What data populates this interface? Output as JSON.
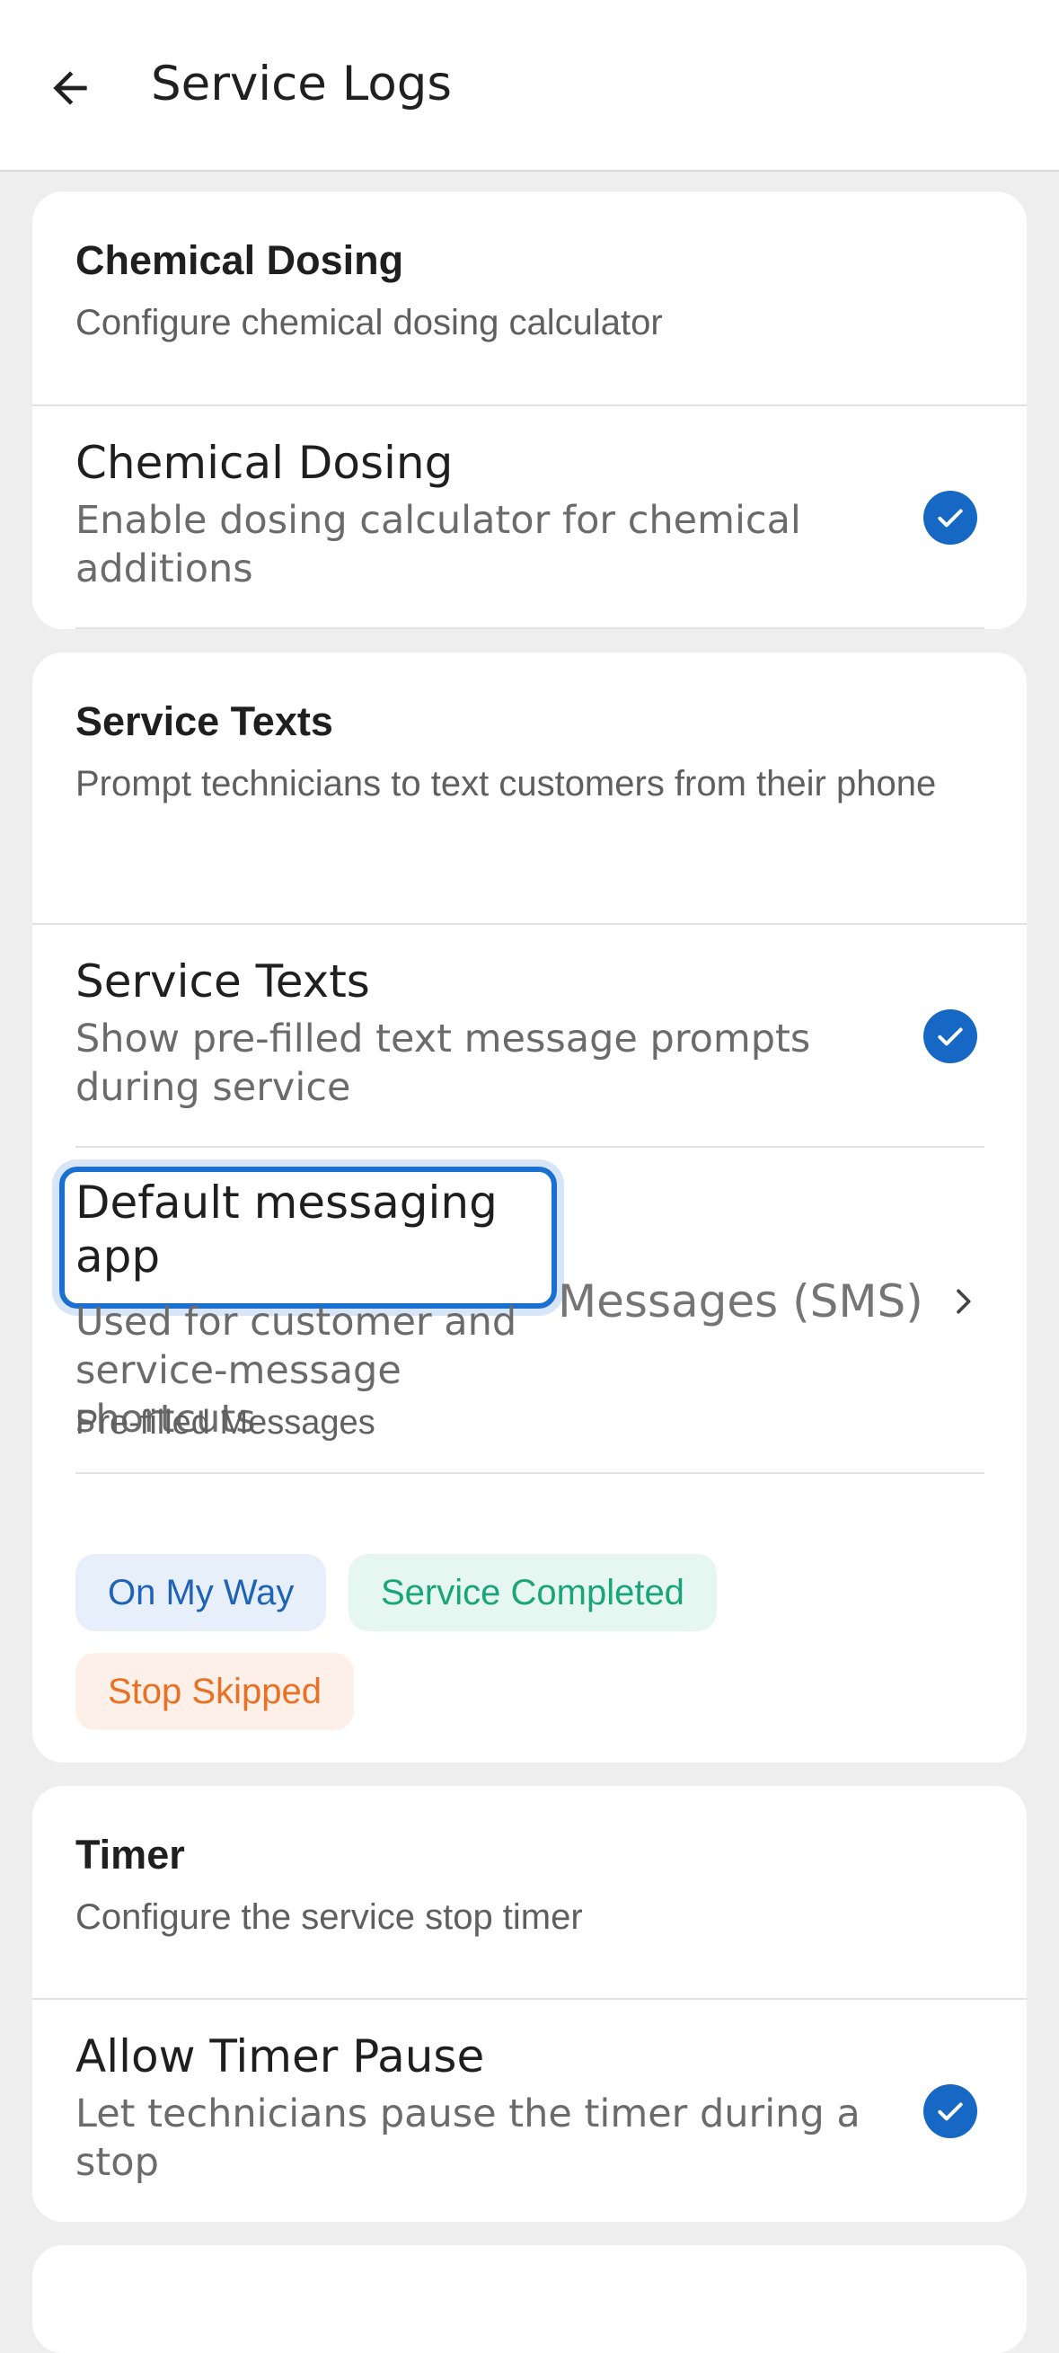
{
  "header": {
    "title": "Service Logs"
  },
  "sections": [
    {
      "title": "Chemical Dosing",
      "subtitle": "Configure chemical dosing calculator",
      "toggle": {
        "label": "Chemical Dosing",
        "description": "Enable dosing calculator for chemical additions",
        "checked": true
      }
    },
    {
      "title": "Service Texts",
      "subtitle": "Prompt technicians to text customers from their phone",
      "toggle": {
        "label": "Service Texts",
        "description": "Show pre-filled text message prompts during service",
        "checked": true
      },
      "messaging_app": {
        "label": "Default messaging app",
        "description": "Used for customer and service-message shortcuts",
        "value": "Messages (SMS)"
      },
      "prefilled": {
        "label": "Pre-filled Messages",
        "chips": [
          "On My Way",
          "Service Completed",
          "Stop Skipped"
        ]
      }
    },
    {
      "title": "Timer",
      "subtitle": "Configure the service stop timer",
      "toggle": {
        "label": "Allow Timer Pause",
        "description": "Let technicians pause the timer during a stop",
        "checked": true
      }
    }
  ],
  "colors": {
    "accent": "#1668c4",
    "background": "#eeeeee",
    "chip_blue": "#1f63b8",
    "chip_green": "#1aa579",
    "chip_orange": "#ea7025"
  }
}
